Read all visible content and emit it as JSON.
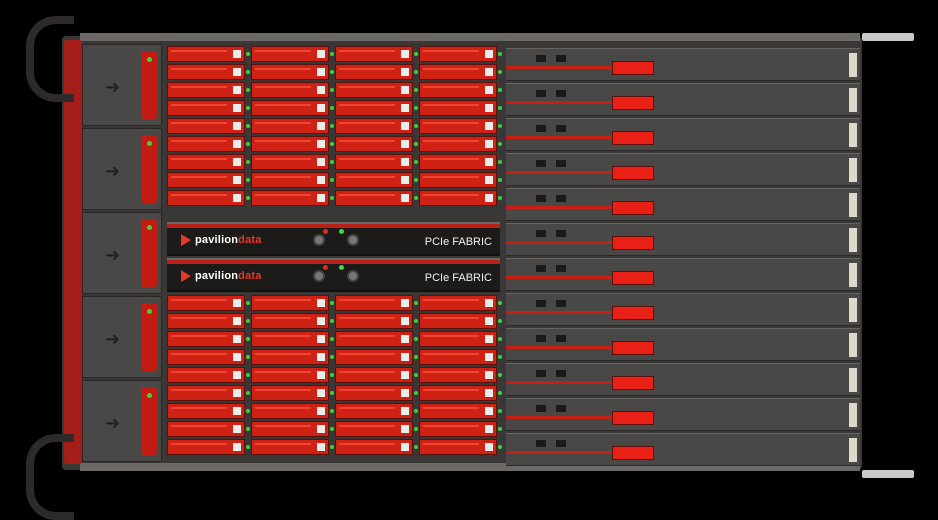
{
  "image": {
    "width": 938,
    "height": 504
  },
  "controllers": [
    {
      "brand_prefix": "pavilion",
      "brand_suffix": "data",
      "fabric_label": "PCIe FABRIC"
    },
    {
      "brand_prefix": "pavilion",
      "brand_suffix": "data",
      "fabric_label": "PCIe FABRIC"
    }
  ],
  "colors": {
    "background": "#000000",
    "chassis": "#3a3836",
    "drive_red": "#cf2214",
    "accent_red": "#e23b2e",
    "status_green": "#39d13b"
  }
}
